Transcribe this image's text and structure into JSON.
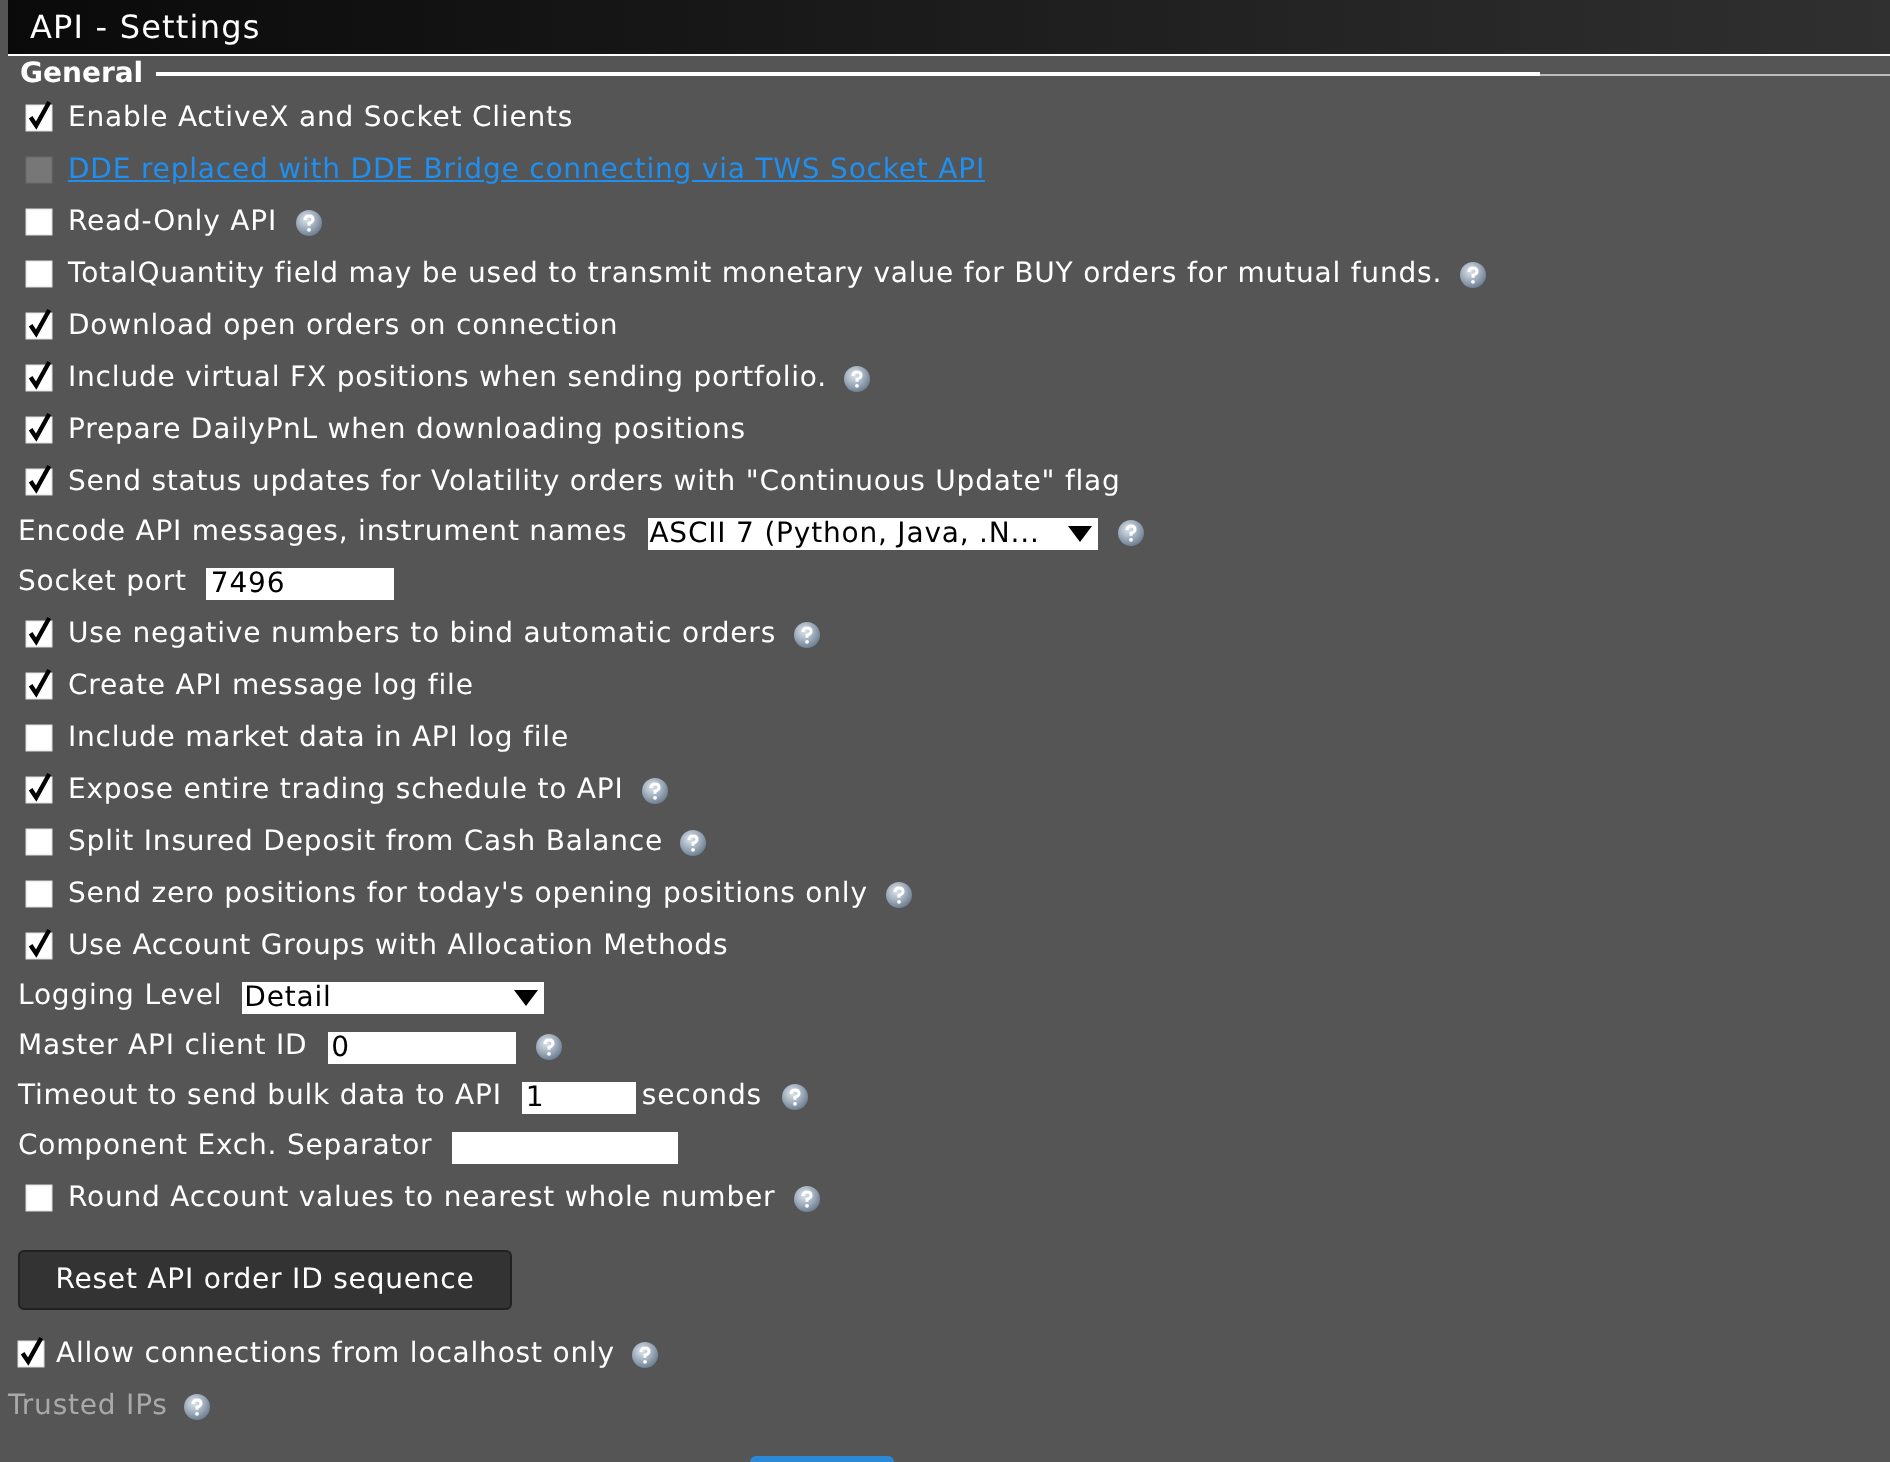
{
  "window": {
    "title": "API - Settings"
  },
  "section": {
    "title": "General"
  },
  "settings": [
    {
      "kind": "checkbox",
      "label": "Enable ActiveX and Socket Clients",
      "checked": true,
      "disabled": false,
      "help": false
    },
    {
      "kind": "checkbox_link",
      "label": "DDE replaced with DDE Bridge connecting via TWS Socket API",
      "checked": false,
      "disabled": true,
      "help": false
    },
    {
      "kind": "checkbox",
      "label": "Read-Only API",
      "checked": false,
      "disabled": false,
      "help": true
    },
    {
      "kind": "checkbox",
      "label": "TotalQuantity field may be used to transmit monetary value for BUY orders for mutual funds.",
      "checked": false,
      "disabled": false,
      "help": true
    },
    {
      "kind": "checkbox",
      "label": "Download open orders on connection",
      "checked": true,
      "disabled": false,
      "help": false
    },
    {
      "kind": "checkbox",
      "label": "Include virtual FX positions when sending portfolio.",
      "checked": true,
      "disabled": false,
      "help": true
    },
    {
      "kind": "checkbox",
      "label": "Prepare DailyPnL when downloading positions",
      "checked": true,
      "disabled": false,
      "help": false
    },
    {
      "kind": "checkbox",
      "label": "Send status updates for Volatility orders with \"Continuous Update\" flag",
      "checked": true,
      "disabled": false,
      "help": false
    },
    {
      "kind": "select",
      "label": "Encode API messages, instrument names",
      "value": "ASCII 7 (Python, Java, .N...",
      "help": true
    },
    {
      "kind": "input",
      "label": "Socket port",
      "value": "7496",
      "help": false
    },
    {
      "kind": "checkbox",
      "label": "Use negative numbers to bind automatic orders",
      "checked": true,
      "disabled": false,
      "help": true
    },
    {
      "kind": "checkbox",
      "label": "Create API message log file",
      "checked": true,
      "disabled": false,
      "help": false
    },
    {
      "kind": "checkbox",
      "label": "Include market data in API log file",
      "checked": false,
      "disabled": false,
      "help": false
    },
    {
      "kind": "checkbox",
      "label": "Expose entire trading schedule to API",
      "checked": true,
      "disabled": false,
      "help": true
    },
    {
      "kind": "checkbox",
      "label": "Split Insured Deposit from Cash Balance",
      "checked": false,
      "disabled": false,
      "help": true
    },
    {
      "kind": "checkbox",
      "label": "Send zero positions for today's opening positions only",
      "checked": false,
      "disabled": false,
      "help": true
    },
    {
      "kind": "checkbox",
      "label": "Use Account Groups with Allocation Methods",
      "checked": true,
      "disabled": false,
      "help": false
    },
    {
      "kind": "select",
      "label": "Logging Level",
      "value": "Detail",
      "help": false
    },
    {
      "kind": "input",
      "label": "Master API client ID",
      "value": "0",
      "help": true
    },
    {
      "kind": "input",
      "label": "Timeout to send bulk data to API",
      "value": "1",
      "suffix": "seconds",
      "help": true
    },
    {
      "kind": "input",
      "label": "Component Exch. Separator",
      "help": false
    },
    {
      "kind": "checkbox",
      "label": "Round Account values to nearest whole number",
      "checked": false,
      "disabled": false,
      "help": true
    }
  ],
  "reset_button": {
    "label": "Reset API order ID sequence"
  },
  "localhost": {
    "label": "Allow connections from localhost only",
    "checked": true,
    "help": true
  },
  "trusted_ips": {
    "label": "Trusted IPs",
    "disabled": true,
    "help": true
  }
}
